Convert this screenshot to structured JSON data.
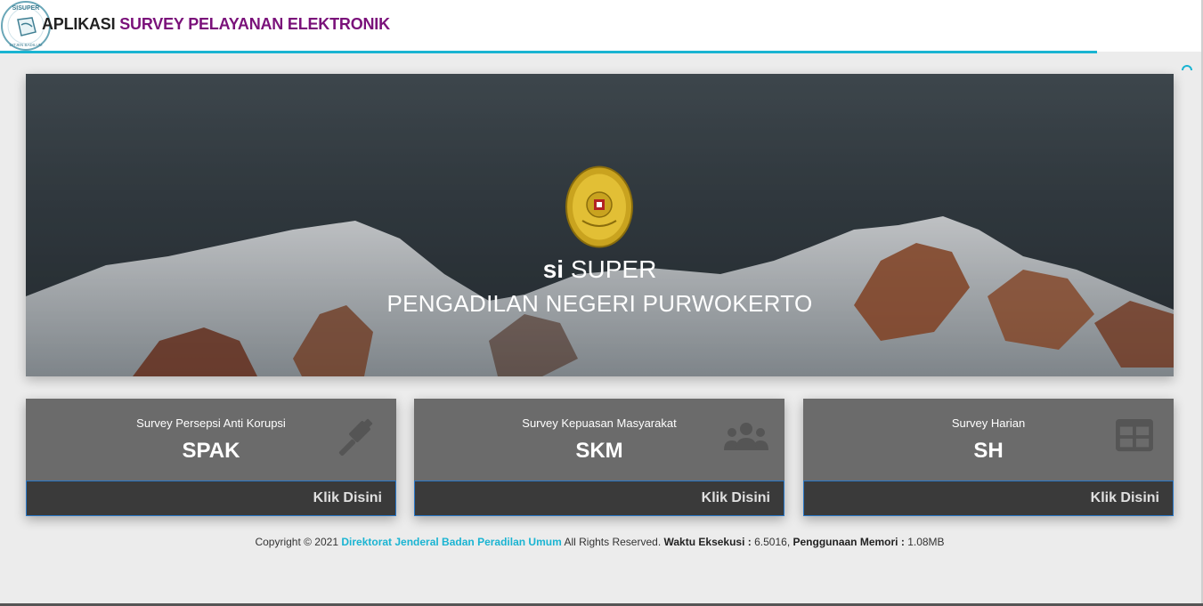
{
  "header": {
    "title_prefix": "APLIKASI",
    "title_highlight": "SURVEY PELAYANAN ELEKTRONIK",
    "logo": {
      "icon": "sisuper-logo",
      "text": "SISUPER",
      "subtext": "DITJEN BADILUM"
    }
  },
  "hero": {
    "emblem_icon": "mahkamah-agung-emblem",
    "title_bold": "si",
    "title_rest": "SUPER",
    "subtitle": "PENGADILAN NEGERI PURWOKERTO"
  },
  "cards": [
    {
      "label": "Survey Persepsi Anti Korupsi",
      "code": "SPAK",
      "icon": "gavel-icon",
      "link": "Klik Disini"
    },
    {
      "label": "Survey Kepuasan Masyarakat",
      "code": "SKM",
      "icon": "users-icon",
      "link": "Klik Disini"
    },
    {
      "label": "Survey Harian",
      "code": "SH",
      "icon": "table-icon",
      "link": "Klik Disini"
    }
  ],
  "footer": {
    "copyright": "Copyright © 2021",
    "org_link": "Direktorat Jenderal Badan Peradilan Umum",
    "rights": "All Rights Reserved.",
    "exec_label": "Waktu Eksekusi :",
    "exec_value": "6.5016,",
    "mem_label": "Penggunaan Memori :",
    "mem_value": "1.08MB"
  },
  "colors": {
    "accent": "#1ab4d2",
    "brand": "#7a117a",
    "card_bg": "#6b6b6b",
    "card_footer": "#3a3a3a"
  }
}
